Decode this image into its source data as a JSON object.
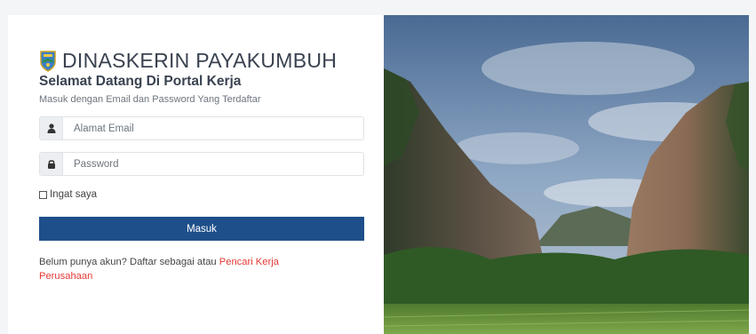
{
  "brand": {
    "logo_icon": "shield-emblem-icon",
    "name": "DINASKERIN PAYAKUMBUH"
  },
  "login": {
    "title": "Selamat Datang Di Portal Kerja",
    "subtitle": "Masuk dengan Email dan Password Yang Terdaftar",
    "email": {
      "icon": "user-icon",
      "placeholder": "Alamat Email",
      "value": ""
    },
    "password": {
      "icon": "lock-icon",
      "placeholder": "Password",
      "value": ""
    },
    "remember_label": "Ingat saya",
    "remember_checked": false,
    "submit_label": "Masuk"
  },
  "register": {
    "prefix": "Belum punya akun? Daftar sebagai atau ",
    "link_jobseeker": "Pencari Kerja",
    "link_company": "Perusahaan"
  },
  "colors": {
    "primary": "#1e4f8a",
    "link": "#e53935",
    "text": "#3a4250"
  }
}
